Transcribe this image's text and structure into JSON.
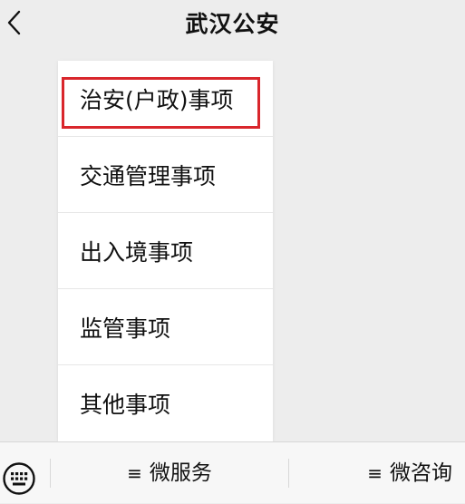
{
  "header": {
    "back_icon": "chevron-left-icon",
    "title": "武汉公安"
  },
  "menu": {
    "items": [
      {
        "label": "治安(户政)事项",
        "highlighted": true
      },
      {
        "label": "交通管理事项"
      },
      {
        "label": "出入境事项"
      },
      {
        "label": "监管事项"
      },
      {
        "label": "其他事项"
      }
    ],
    "highlight_color": "#d9262c"
  },
  "bottom_bar": {
    "keyboard_icon": "keyboard-icon",
    "menu_glyph": "≡",
    "buttons": [
      {
        "label": "微服务"
      },
      {
        "label": "微咨询"
      }
    ]
  }
}
